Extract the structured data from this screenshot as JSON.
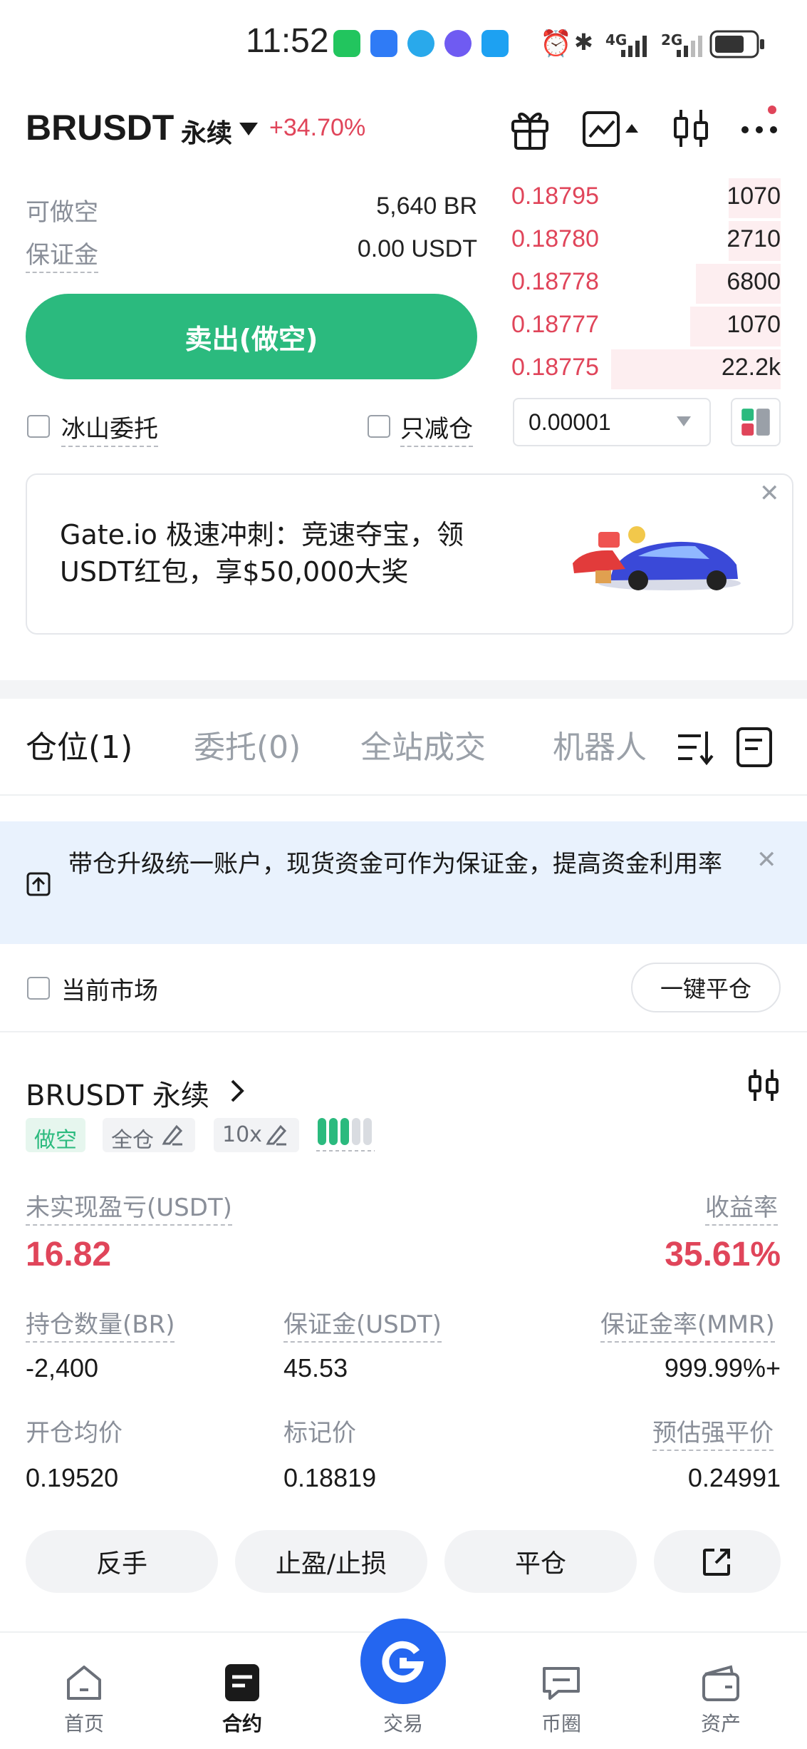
{
  "status_bar": {
    "time": "11:52",
    "network_4g": "4G",
    "network_2g": "2G"
  },
  "header": {
    "symbol": "BRUSDT",
    "contract_type": "永续",
    "change": "+34.70%"
  },
  "order_panel": {
    "shortable_label": "可做空",
    "shortable_value": "5,640 BR",
    "margin_label": "保证金",
    "margin_value": "0.00 USDT",
    "sell_button": "卖出(做空)",
    "iceberg_label": "冰山委托",
    "reduce_only_label": "只减仓"
  },
  "orderbook": {
    "asks": [
      {
        "price": "0.18795",
        "qty": "1070",
        "depth": 0.19
      },
      {
        "price": "0.18780",
        "qty": "2710",
        "depth": 0.19
      },
      {
        "price": "0.18778",
        "qty": "6800",
        "depth": 0.31
      },
      {
        "price": "0.18777",
        "qty": "1070",
        "depth": 0.33
      },
      {
        "price": "0.18775",
        "qty": "22.2k",
        "depth": 0.62
      }
    ],
    "tick_size": "0.00001"
  },
  "promo_banner": {
    "text": "Gate.io 极速冲刺：竞速夺宝，领USDT红包，享$50,000大奖"
  },
  "tabs": [
    {
      "label": "仓位(1)",
      "active": true
    },
    {
      "label": "委托(0)",
      "active": false
    },
    {
      "label": "全站成交",
      "active": false
    },
    {
      "label": "机器人",
      "active": false
    }
  ],
  "notice": {
    "text": "带仓升级统一账户，现货资金可作为保证金，提高资金利用率"
  },
  "filter": {
    "current_market_label": "当前市场",
    "close_all_button": "一键平仓"
  },
  "position": {
    "title": "BRUSDT 永续",
    "side_tag": "做空",
    "margin_mode_tag": "全仓",
    "leverage_tag": "10x",
    "unrealized_label": "未实现盈亏(USDT)",
    "unrealized_value": "16.82",
    "roe_label": "收益率",
    "roe_value": "35.61%",
    "size_label": "持仓数量(BR)",
    "size_value": "-2,400",
    "margin_label": "保证金(USDT)",
    "margin_value": "45.53",
    "mmr_label": "保证金率(MMR)",
    "mmr_value": "999.99%+",
    "entry_label": "开仓均价",
    "entry_value": "0.19520",
    "mark_label": "标记价",
    "mark_value": "0.18819",
    "liq_label": "预估强平价",
    "liq_value": "0.24991",
    "actions": [
      "反手",
      "止盈/止损",
      "平仓"
    ]
  },
  "bottom_nav": [
    {
      "label": "首页",
      "active": false
    },
    {
      "label": "合约",
      "active": true
    },
    {
      "label": "交易",
      "active": false
    },
    {
      "label": "币圈",
      "active": false
    },
    {
      "label": "资产",
      "active": false
    }
  ],
  "colors": {
    "green": "#2bba7e",
    "red": "#e0455a",
    "blue": "#2466f0"
  }
}
